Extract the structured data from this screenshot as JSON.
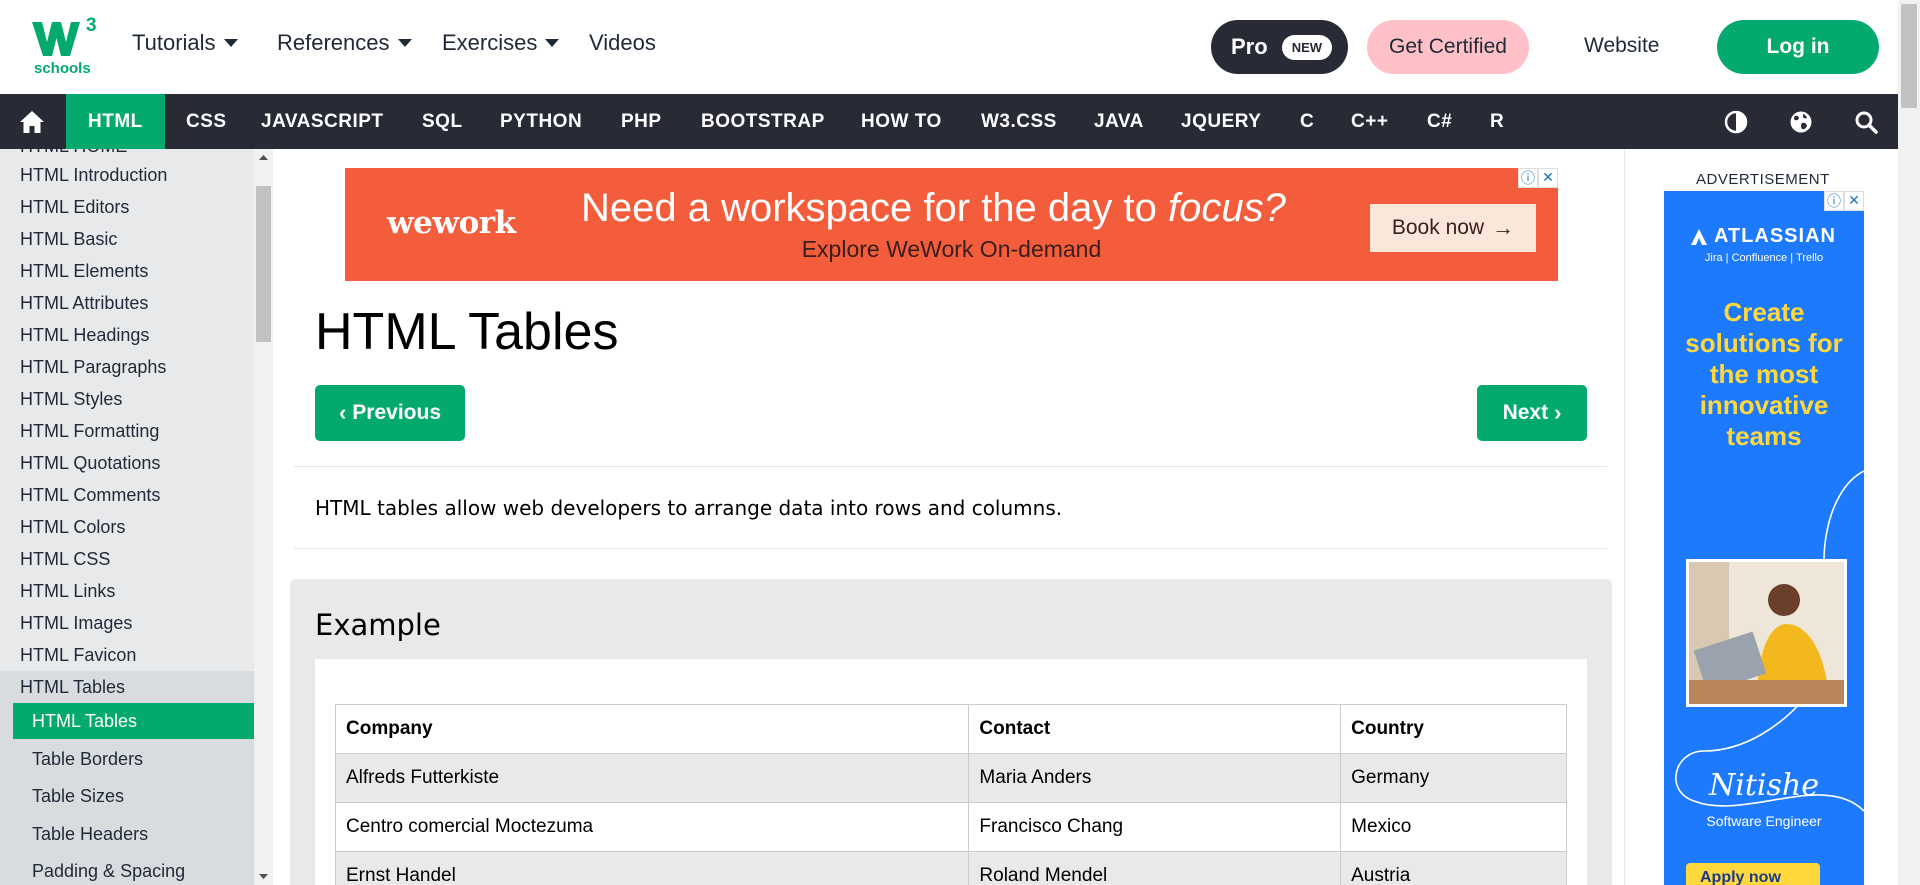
{
  "logo": {
    "superscript": "3",
    "text": "schools"
  },
  "topnav": {
    "tutorials": "Tutorials",
    "references": "References",
    "exercises": "Exercises",
    "videos": "Videos",
    "pro": "Pro",
    "pro_badge": "NEW",
    "get_certified": "Get Certified",
    "website": "Website",
    "login": "Log in"
  },
  "langnav": {
    "items": [
      "HTML",
      "CSS",
      "JAVASCRIPT",
      "SQL",
      "PYTHON",
      "PHP",
      "BOOTSTRAP",
      "HOW TO",
      "W3.CSS",
      "JAVA",
      "JQUERY",
      "C",
      "C++",
      "C#",
      "R"
    ],
    "active": "HTML"
  },
  "sidebar": {
    "partial_top": "HTML HOME",
    "items": [
      "HTML Introduction",
      "HTML Editors",
      "HTML Basic",
      "HTML Elements",
      "HTML Attributes",
      "HTML Headings",
      "HTML Paragraphs",
      "HTML Styles",
      "HTML Formatting",
      "HTML Quotations",
      "HTML Comments",
      "HTML Colors",
      "HTML CSS",
      "HTML Links",
      "HTML Images",
      "HTML Favicon"
    ],
    "group": "HTML Tables",
    "subitems": [
      "HTML Tables",
      "Table Borders",
      "Table Sizes",
      "Table Headers",
      "Padding & Spacing"
    ],
    "active_sub": "HTML Tables"
  },
  "banner_ad": {
    "brand": "wework",
    "headline_pre": "Need a workspace for the day to ",
    "headline_em": "focus?",
    "sub": "Explore WeWork On-demand",
    "cta": "Book now"
  },
  "main": {
    "title": "HTML Tables",
    "prev": "Previous",
    "next": "Next",
    "intro": "HTML tables allow web developers to arrange data into rows and columns.",
    "example_title": "Example"
  },
  "table": {
    "headers": [
      "Company",
      "Contact",
      "Country"
    ],
    "rows": [
      [
        "Alfreds Futterkiste",
        "Maria Anders",
        "Germany"
      ],
      [
        "Centro comercial Moctezuma",
        "Francisco Chang",
        "Mexico"
      ],
      [
        "Ernst Handel",
        "Roland Mendel",
        "Austria"
      ]
    ]
  },
  "side_ad": {
    "label": "ADVERTISEMENT",
    "brand": "ATLASSIAN",
    "products": "Jira | Confluence | Trello",
    "headline": "Create solutions for the most innovative teams",
    "signature": "Nitishe",
    "role": "Software Engineer",
    "cta": "Apply now"
  },
  "colors": {
    "brand_green": "#04aa6d",
    "dark_nav": "#282a35",
    "cert_pink": "#ffc0c7",
    "ad_orange": "#f45d3b",
    "atlassian_blue": "#1d7afc"
  }
}
